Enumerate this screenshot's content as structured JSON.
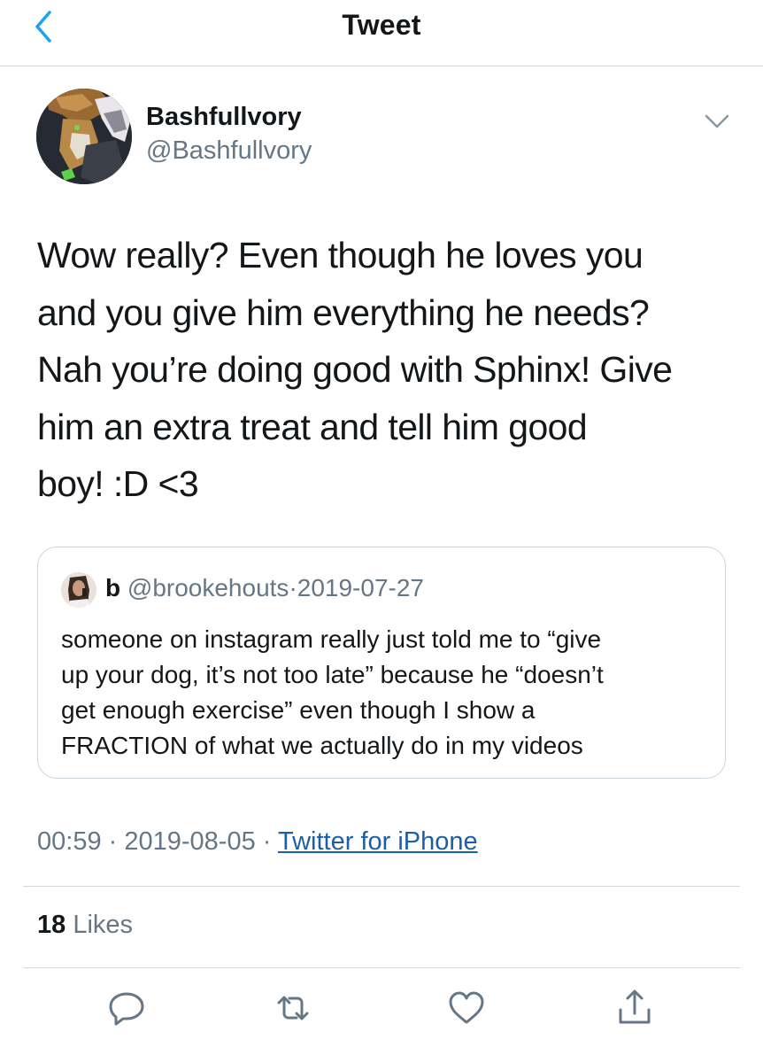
{
  "header": {
    "title": "Tweet",
    "back_icon": "chevron-left-icon"
  },
  "author": {
    "display_name": "Bashfullvory",
    "handle": "@Bashfullvory",
    "avatar": "avatar-image",
    "more_icon": "chevron-down-icon"
  },
  "tweet": {
    "text_lines": [
      "Wow really? Even though he loves you",
      "and you give him everything he needs?",
      "Nah you’re doing good with Sphinx! Give",
      "him an extra treat and tell him good",
      "boy! :D <3"
    ]
  },
  "quoted": {
    "name": "b",
    "handle": "@brookehouts",
    "separator": "·",
    "date": "2019-07-27",
    "text_lines": [
      "someone on instagram really just told me to “give",
      "up your dog, it’s not too late” because he “doesn’t",
      "get enough exercise” even though I show a",
      "FRACTION of what we actually do in my videos"
    ]
  },
  "meta": {
    "time": "00:59",
    "separator": "·",
    "date": "2019-08-05",
    "source": "Twitter for iPhone"
  },
  "stats": {
    "likes_count": "18",
    "likes_label": "Likes"
  },
  "actions": {
    "reply_icon": "reply-icon",
    "retweet_icon": "retweet-icon",
    "like_icon": "heart-icon",
    "share_icon": "share-icon"
  },
  "colors": {
    "text": "#14171a",
    "secondary": "#657786",
    "link": "#1b5fa8",
    "border": "#ccd6dd",
    "accent": "#1da1f2"
  }
}
